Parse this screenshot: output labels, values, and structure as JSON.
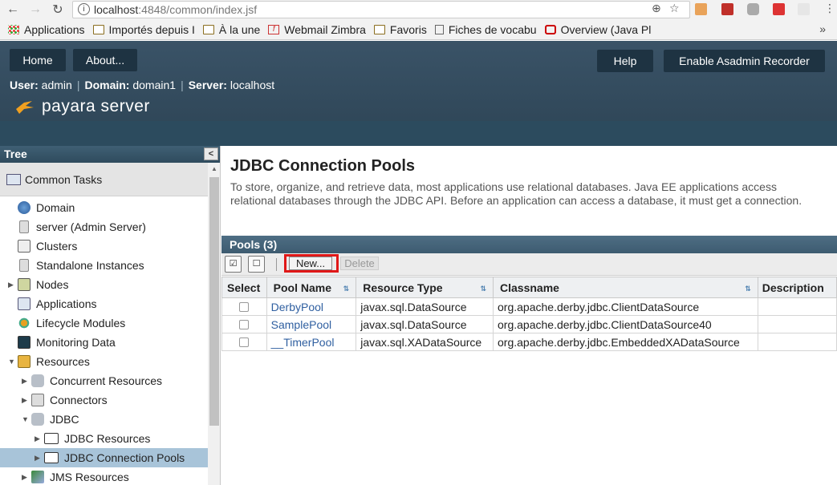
{
  "browser": {
    "url_host": "localhost",
    "url_path": ":4848/common/index.jsf",
    "bookmarks": [
      "Applications",
      "Importés depuis I",
      "À la une",
      "Webmail Zimbra",
      "Favoris",
      "Fiches de vocabu",
      "Overview (Java Pl"
    ],
    "more": "»"
  },
  "header": {
    "home_label": "Home",
    "about_label": "About...",
    "help_label": "Help",
    "recorder_label": "Enable Asadmin Recorder",
    "user_key": "User:",
    "user_val": " admin",
    "domain_key": "Domain:",
    "domain_val": " domain1",
    "server_key": "Server:",
    "server_val": " localhost",
    "logo_text": "payara server"
  },
  "tree": {
    "title": "Tree",
    "collapse": "<",
    "common_tasks": "Common Tasks",
    "items": [
      {
        "label": "Domain"
      },
      {
        "label": "server (Admin Server)"
      },
      {
        "label": "Clusters"
      },
      {
        "label": "Standalone Instances"
      },
      {
        "label": "Nodes"
      },
      {
        "label": "Applications"
      },
      {
        "label": "Lifecycle Modules"
      },
      {
        "label": "Monitoring Data"
      },
      {
        "label": "Resources"
      },
      {
        "label": "Concurrent Resources"
      },
      {
        "label": "Connectors"
      },
      {
        "label": "JDBC"
      },
      {
        "label": "JDBC Resources"
      },
      {
        "label": "JDBC Connection Pools"
      },
      {
        "label": "JMS Resources"
      }
    ]
  },
  "main": {
    "title": "JDBC Connection Pools",
    "description": "To store, organize, and retrieve data, most applications use relational databases. Java EE applications access relational databases through the JDBC API. Before an application can access a database, it must get a connection.",
    "table_title": "Pools (3)",
    "new_label": "New...",
    "delete_label": "Delete",
    "columns": [
      "Select",
      "Pool Name",
      "Resource Type",
      "Classname",
      "Description"
    ],
    "rows": [
      {
        "name": "DerbyPool",
        "type": "javax.sql.DataSource",
        "classname": "org.apache.derby.jdbc.ClientDataSource",
        "description": ""
      },
      {
        "name": "SamplePool",
        "type": "javax.sql.DataSource",
        "classname": "org.apache.derby.jdbc.ClientDataSource40",
        "description": ""
      },
      {
        "name": "__TimerPool",
        "type": "javax.sql.XADataSource",
        "classname": "org.apache.derby.jdbc.EmbeddedXADataSource",
        "description": ""
      }
    ]
  }
}
